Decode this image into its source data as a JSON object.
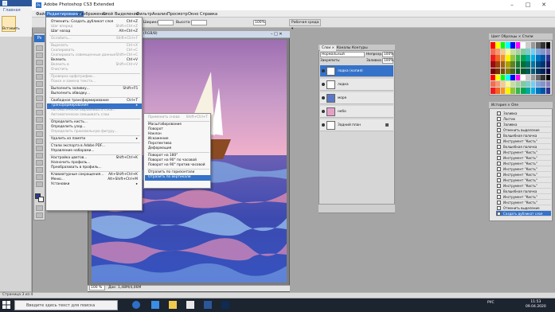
{
  "word": {
    "tab": "Главная",
    "paste_label": "Вставить",
    "status_text": "Страница 3 из 4"
  },
  "titlebar": {
    "logo": "Ps",
    "title": "Adobe Photoshop CS3 Extended",
    "minimize": "–",
    "maximize": "□",
    "close": "✕"
  },
  "menubar": [
    "Файл",
    "Редактирование",
    "Изображение",
    "Слой",
    "Выделение",
    "Фильтр",
    "Анализ",
    "Просмотр",
    "Окно",
    "Справка"
  ],
  "options": {
    "width_label": "Ширина:",
    "width_val": "",
    "height_label": "Высота:",
    "height_val": "",
    "res_val": "100%",
    "workspace": "Рабочая среда ▾"
  },
  "toolbox": {
    "logo": "Ps"
  },
  "document": {
    "title": "(RGB/8)",
    "controls": "– □ ✕",
    "zoom": "100 %",
    "info": "Док: 1,48M/4,06M"
  },
  "edit_menu": [
    {
      "label": "Отменить: Создать дубликат слоя",
      "shortcut": "Ctrl+Z",
      "disabled": false
    },
    {
      "label": "Шаг вперед",
      "shortcut": "Shift+Ctrl+Z",
      "disabled": true
    },
    {
      "label": "Шаг назад",
      "shortcut": "Alt+Ctrl+Z",
      "disabled": false
    },
    {
      "sep": true
    },
    {
      "label": "Ослабить...",
      "shortcut": "Shift+Ctrl+F",
      "disabled": true
    },
    {
      "sep": true
    },
    {
      "label": "Вырезать",
      "shortcut": "Ctrl+X",
      "disabled": true
    },
    {
      "label": "Скопировать",
      "shortcut": "Ctrl+C",
      "disabled": true
    },
    {
      "label": "Скопировать совмещенные данные",
      "shortcut": "Shift+Ctrl+C",
      "disabled": true
    },
    {
      "label": "Вклеить",
      "shortcut": "Ctrl+V",
      "disabled": false
    },
    {
      "label": "Вклеить в",
      "shortcut": "Shift+Ctrl+V",
      "disabled": true
    },
    {
      "label": "Очистить",
      "shortcut": "",
      "disabled": true
    },
    {
      "sep": true
    },
    {
      "label": "Проверка орфографии...",
      "shortcut": "",
      "disabled": true
    },
    {
      "label": "Поиск и замена текста...",
      "shortcut": "",
      "disabled": true
    },
    {
      "sep": true
    },
    {
      "label": "Выполнить заливку...",
      "shortcut": "Shift+F5",
      "disabled": false
    },
    {
      "label": "Выполнить обводку...",
      "shortcut": "",
      "disabled": false
    },
    {
      "sep": true
    },
    {
      "label": "Свободное трансформирование",
      "shortcut": "Ctrl+T",
      "disabled": false
    },
    {
      "label": "Трансформирование",
      "shortcut": "▸",
      "disabled": false,
      "highlight": true
    },
    {
      "label": "Автоматически выравнивать слои...",
      "shortcut": "",
      "disabled": true
    },
    {
      "label": "Автоматически смешивать слои",
      "shortcut": "",
      "disabled": true
    },
    {
      "sep": true
    },
    {
      "label": "Определить кисть...",
      "shortcut": "",
      "disabled": false
    },
    {
      "label": "Определить узор...",
      "shortcut": "",
      "disabled": false
    },
    {
      "label": "Определить произвольную фигуру...",
      "shortcut": "",
      "disabled": true
    },
    {
      "sep": true
    },
    {
      "label": "Удалить из памяти",
      "shortcut": "▸",
      "disabled": false
    },
    {
      "sep": true
    },
    {
      "label": "Стили экспорта в Adobe PDF...",
      "shortcut": "",
      "disabled": false
    },
    {
      "label": "Управление наборами...",
      "shortcut": "",
      "disabled": false
    },
    {
      "sep": true
    },
    {
      "label": "Настройка цветов...",
      "shortcut": "Shift+Ctrl+K",
      "disabled": false
    },
    {
      "label": "Назначить профиль...",
      "shortcut": "",
      "disabled": false
    },
    {
      "label": "Преобразовать в профиль...",
      "shortcut": "",
      "disabled": false
    },
    {
      "sep": true
    },
    {
      "label": "Клавиатурные сокращения...",
      "shortcut": "Alt+Shift+Ctrl+K",
      "disabled": false
    },
    {
      "label": "Меню...",
      "shortcut": "Alt+Shift+Ctrl+M",
      "disabled": false
    },
    {
      "label": "Установки",
      "shortcut": "▸",
      "disabled": false
    }
  ],
  "sub_menu": [
    {
      "label": "Применить снова",
      "shortcut": "Shift+Ctrl+T",
      "disabled": true
    },
    {
      "sep": true
    },
    {
      "label": "Масштабирование",
      "disabled": false
    },
    {
      "label": "Поворот",
      "disabled": false
    },
    {
      "label": "Наклон",
      "disabled": false
    },
    {
      "label": "Искажение",
      "disabled": false
    },
    {
      "label": "Перспектива",
      "disabled": false
    },
    {
      "label": "Деформация",
      "disabled": false
    },
    {
      "sep": true
    },
    {
      "label": "Поворот на 180°",
      "disabled": false
    },
    {
      "label": "Поворот на 90° по часовой",
      "disabled": false
    },
    {
      "label": "Поворот на 90° против часовой",
      "disabled": false
    },
    {
      "sep": true
    },
    {
      "label": "Отразить по горизонтали",
      "disabled": false
    },
    {
      "label": "Отразить по вертикали",
      "disabled": false,
      "highlight": true
    }
  ],
  "layers": {
    "tabs": [
      "Слои ×",
      "Каналы",
      "Контуры"
    ],
    "blend_mode": "Нормальный",
    "opacity_label": "Непрозр.:",
    "opacity": "100%",
    "lock_label": "Закрепить:",
    "fill_label": "Заливка:",
    "fill": "100%",
    "items": [
      {
        "name": "лодка (копия)",
        "selected": true,
        "thumb": "#ffffff"
      },
      {
        "name": "лодка",
        "selected": false,
        "thumb": "#ffffff"
      },
      {
        "name": "море",
        "selected": false,
        "thumb": "#5a78c8"
      },
      {
        "name": "небо",
        "selected": false,
        "thumb": "#e6a0c8"
      },
      {
        "name": "Задний план",
        "selected": false,
        "thumb": "#ffffff",
        "locked": true
      }
    ]
  },
  "swatches": {
    "tabs": "Цвет  Образцы ×  Стили"
  },
  "history": {
    "tabs": "История ×  Опе",
    "items": [
      {
        "label": "Заливка",
        "selected": false
      },
      {
        "label": "Ластик",
        "selected": false
      },
      {
        "label": "Заливка",
        "selected": false
      },
      {
        "label": "Отменить выделение",
        "selected": false
      },
      {
        "label": "Волшебная палочка",
        "selected": false
      },
      {
        "label": "Инструмент \"Кисть\"",
        "selected": false
      },
      {
        "label": "Волшебная палочка",
        "selected": false
      },
      {
        "label": "Инструмент \"Кисть\"",
        "selected": false
      },
      {
        "label": "Инструмент \"Кисть\"",
        "selected": false
      },
      {
        "label": "Инструмент \"Кисть\"",
        "selected": false
      },
      {
        "label": "Инструмент \"Кисть\"",
        "selected": false
      },
      {
        "label": "Инструмент \"Кисть\"",
        "selected": false
      },
      {
        "label": "Инструмент \"Кисть\"",
        "selected": false
      },
      {
        "label": "Инструмент \"Кисть\"",
        "selected": false
      },
      {
        "label": "Волшебная палочка",
        "selected": false
      },
      {
        "label": "Инструмент \"Кисть\"",
        "selected": false
      },
      {
        "label": "Инструмент \"Кисть\"",
        "selected": false
      },
      {
        "label": "Отменить выделение",
        "selected": false
      },
      {
        "label": "Создать дубликат слоя",
        "selected": true
      }
    ]
  },
  "taskbar": {
    "search_placeholder": "Введите здесь текст для поиска",
    "tray": "РУС",
    "time": "11:53",
    "date": "09.04.2020"
  },
  "colors": {
    "menu_highlight": "#3572c9",
    "foreground": "#2d3b8a",
    "background": "#ffffff"
  }
}
